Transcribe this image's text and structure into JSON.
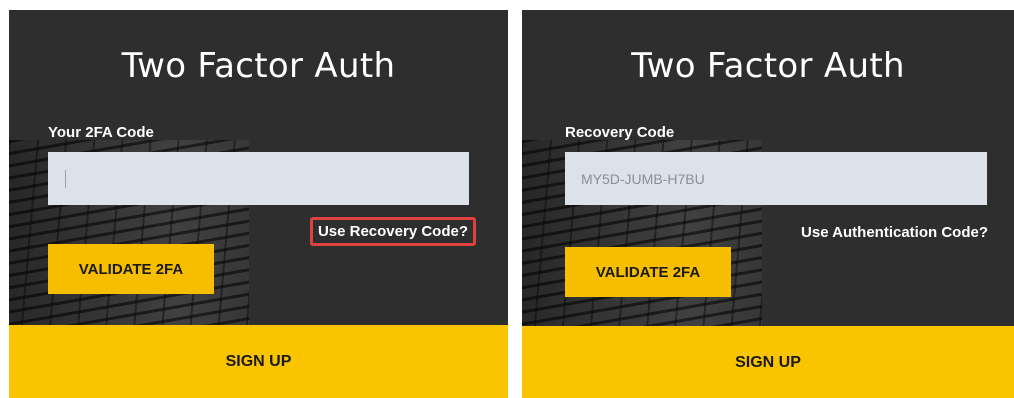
{
  "left_panel": {
    "title": "Two Factor Auth",
    "field_label": "Your 2FA Code",
    "input_value": "",
    "switch_link": "Use Recovery Code?",
    "validate_label": "VALIDATE 2FA",
    "signup_label": "SIGN UP"
  },
  "right_panel": {
    "title": "Two Factor Auth",
    "field_label": "Recovery Code",
    "input_value": "MY5D-JUMB-H7BU",
    "switch_link": "Use Authentication Code?",
    "validate_label": "VALIDATE 2FA",
    "signup_label": "SIGN UP"
  },
  "colors": {
    "panel_bg": "#2e2e2e",
    "accent_yellow": "#fbc400",
    "highlight_red": "#e0413f",
    "input_bg": "#dde1ea"
  }
}
